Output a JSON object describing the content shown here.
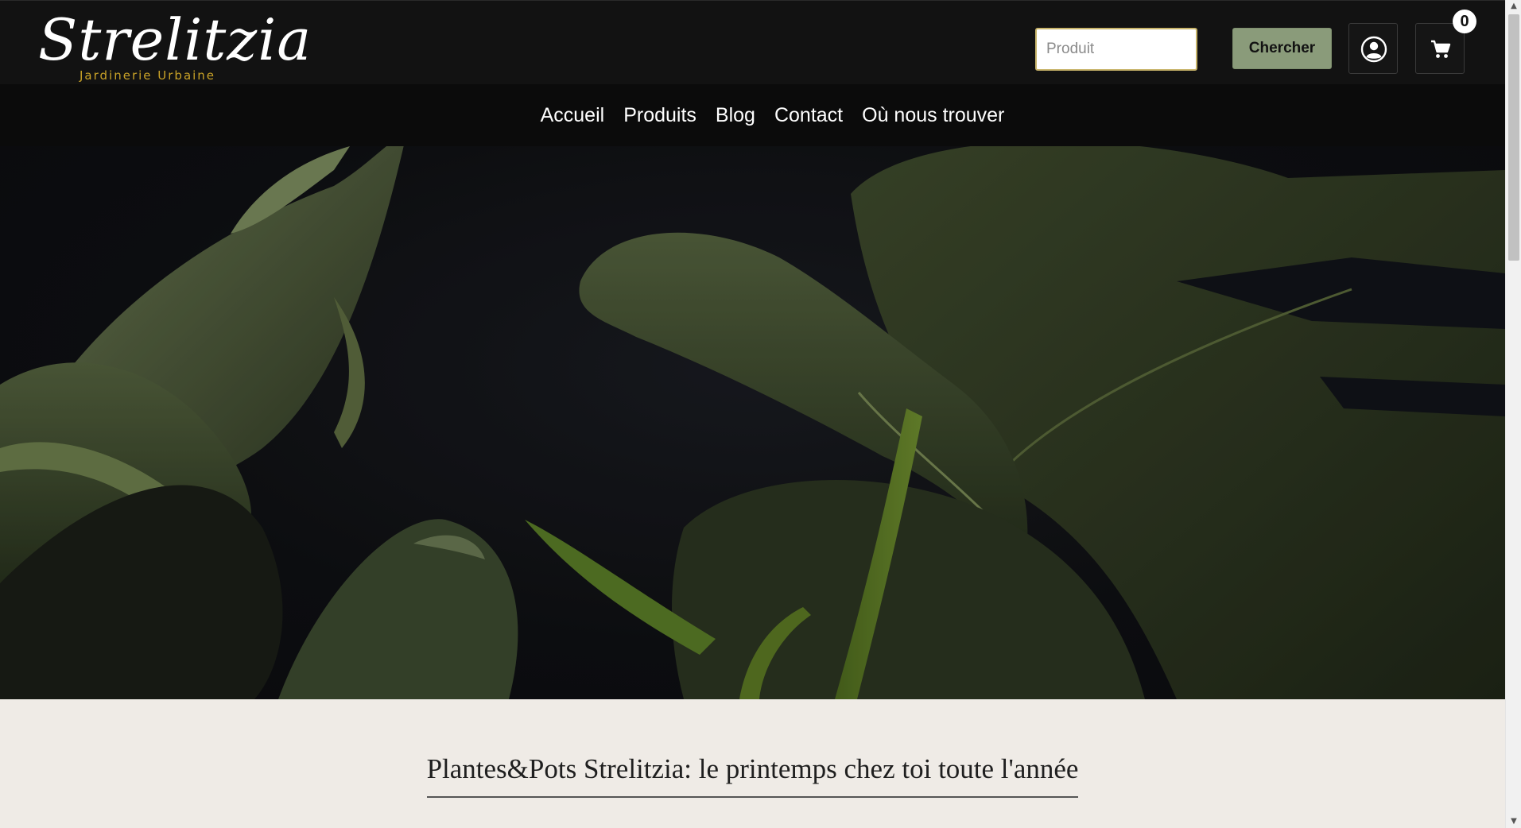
{
  "brand": {
    "name": "Strelitzia",
    "tagline": "Jardinerie Urbaine"
  },
  "search": {
    "placeholder": "Produit",
    "button_label": "Chercher"
  },
  "header": {
    "cart_count": "0",
    "icons": [
      "user-icon",
      "cart-icon"
    ]
  },
  "nav": {
    "items": [
      {
        "label": "Accueil"
      },
      {
        "label": "Produits"
      },
      {
        "label": "Blog"
      },
      {
        "label": "Contact"
      },
      {
        "label": "Où nous trouver"
      }
    ]
  },
  "hero": {
    "image": "monstera-leaves-dark-background"
  },
  "main": {
    "headline": "Plantes&Pots Strelitzia: le printemps chez toi toute l'année"
  },
  "colors": {
    "header_bg": "#121212",
    "nav_bg": "#0b0b0b",
    "accent_gold": "#c9a227",
    "button_sage": "#8a9b7a",
    "content_bg": "#efebe6"
  }
}
